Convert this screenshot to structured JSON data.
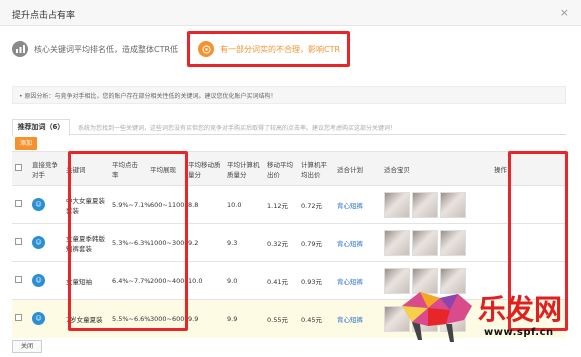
{
  "dialog": {
    "title": "提升点击占有率",
    "close_glyph": "×"
  },
  "issues": [
    {
      "icon": "bar-chart-icon",
      "text": "核心关键词平均排名低，造成整体CTR低"
    },
    {
      "icon": "target-icon",
      "text": "有一部分词实的不合理，影响CTR"
    }
  ],
  "notice": "• 原因分析：与竞争对手相比，您的账户存在部分相关性低的关键词。建议您优化账户买词结构！",
  "tab": {
    "label": "推荐加词（6）",
    "hint": "系统为您找到一些关键词，这些词您没有买但您的竞争对手购买后取得了较高的点击率。建议您考虑购买这部分关键词！"
  },
  "add_button": "添加",
  "table": {
    "headers": [
      "直接竞争对手",
      "关键词",
      "平均点击率",
      "平均展现",
      "平均移动质量分",
      "平均计算机质量分",
      "移动平均出价",
      "计算机平均出价",
      "适合计划",
      "适合宝贝",
      "操作"
    ],
    "avatar_glyph": "☺",
    "rows": [
      {
        "keyword": "中大女童夏装套装",
        "ctr": "5.9%~7.1%",
        "impr": "600~1100",
        "mq": "8.8",
        "pq": "10.0",
        "mbid": "1.12元",
        "pbid": "0.72元",
        "plan": "背心短裤"
      },
      {
        "keyword": "女童夏季韩版短裤套装",
        "ctr": "5.3%~6.3%",
        "impr": "1000~3000",
        "mq": "9.2",
        "pq": "9.3",
        "mbid": "0.32元",
        "pbid": "0.79元",
        "plan": "背心短裤"
      },
      {
        "keyword": "女童短袖",
        "ctr": "6.4%~7.7%",
        "impr": "2000~4000",
        "mq": "10.0",
        "pq": "9.0",
        "mbid": "0.41元",
        "pbid": "0.93元",
        "plan": "背心短裤"
      },
      {
        "keyword": "7岁女童夏装",
        "ctr": "5.5%~6.6%",
        "impr": "3000~6000",
        "mq": "9.9",
        "pq": "9.9",
        "mbid": "0.55元",
        "pbid": "0.45元",
        "plan": "背心短裤"
      }
    ]
  },
  "watermark": {
    "brand": "乐发网",
    "url": "www.spf.cn"
  },
  "close_button": "关闭",
  "colors": {
    "accent_orange": "#f5922e",
    "highlight_red": "#e8262a",
    "link_blue": "#2a6fd3"
  }
}
